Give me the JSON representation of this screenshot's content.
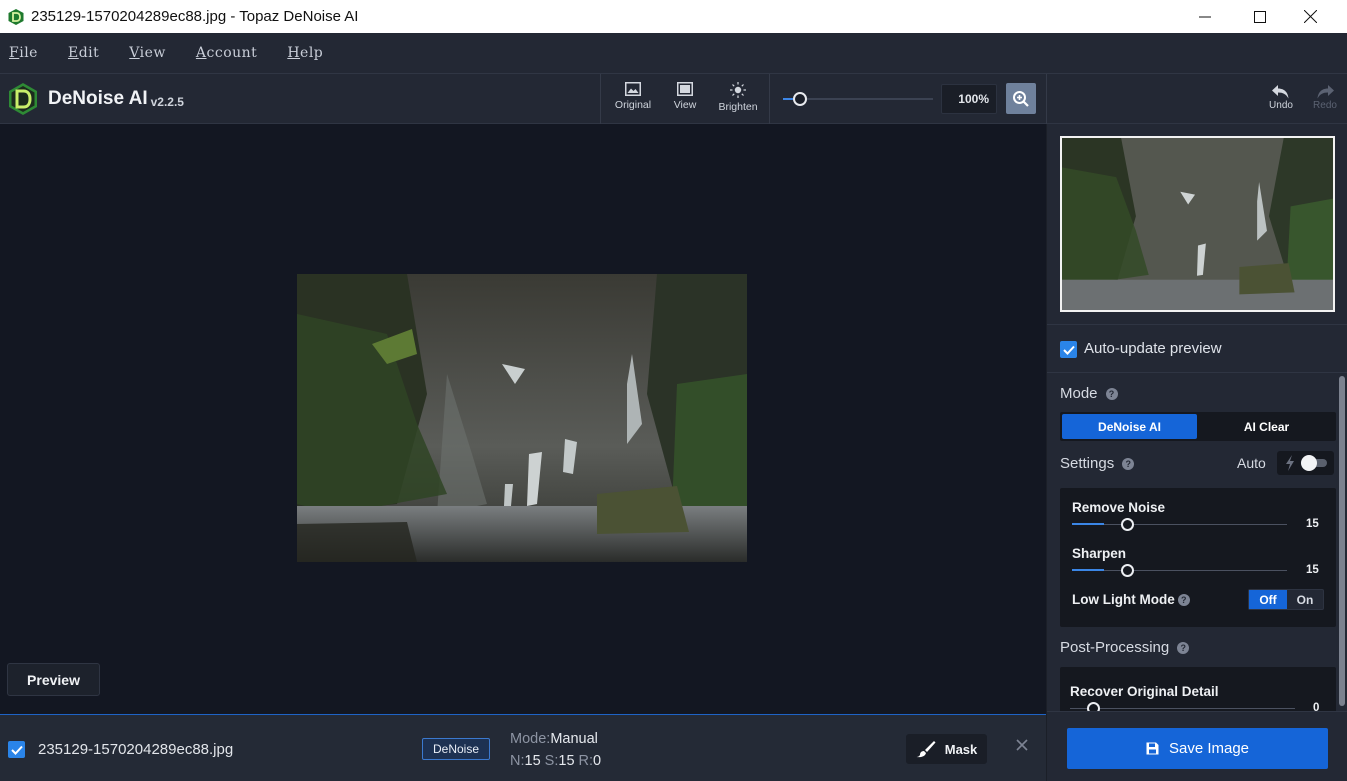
{
  "window": {
    "title": "235129-1570204289ec88.jpg - Topaz DeNoise AI"
  },
  "menu": [
    "File",
    "Edit",
    "View",
    "Account",
    "Help"
  ],
  "brand": {
    "name": "DeNoise AI",
    "version": "v2.2.5"
  },
  "toolbar": {
    "original_label": "Original",
    "view_label": "View",
    "brighten_label": "Brighten",
    "zoom_value": "100%",
    "zoom_level": 0.1,
    "undo_label": "Undo",
    "redo_label": "Redo"
  },
  "canvas": {
    "preview_label": "Preview"
  },
  "filebar": {
    "checked": true,
    "file_name": "235129-1570204289ec88.jpg",
    "badge": "DeNoise",
    "mode_label": "Mode:",
    "mode_value": "Manual",
    "n_label": "N:",
    "n_value": "15",
    "s_label": "S:",
    "s_value": "15",
    "r_label": "R:",
    "r_value": "0",
    "mask_label": "Mask"
  },
  "panel": {
    "auto_update_label": "Auto-update preview",
    "auto_update_checked": true,
    "mode_label": "Mode",
    "mode_options": [
      "DeNoise AI",
      "AI Clear"
    ],
    "mode_selected": "DeNoise AI",
    "settings_label": "Settings",
    "auto_label": "Auto",
    "auto_enabled": false,
    "remove_noise_label": "Remove Noise",
    "remove_noise_value": "15",
    "remove_noise_level": 0.15,
    "sharpen_label": "Sharpen",
    "sharpen_value": "15",
    "sharpen_level": 0.15,
    "low_light_label": "Low Light Mode",
    "low_light_off": "Off",
    "low_light_on": "On",
    "low_light_selected": "Off",
    "post_processing_label": "Post-Processing",
    "recover_label": "Recover Original Detail",
    "recover_value": "0",
    "recover_level": 0,
    "save_label": "Save Image"
  },
  "colors": {
    "accent": "#1565d8",
    "panel": "#232834",
    "canvas": "#131722"
  }
}
